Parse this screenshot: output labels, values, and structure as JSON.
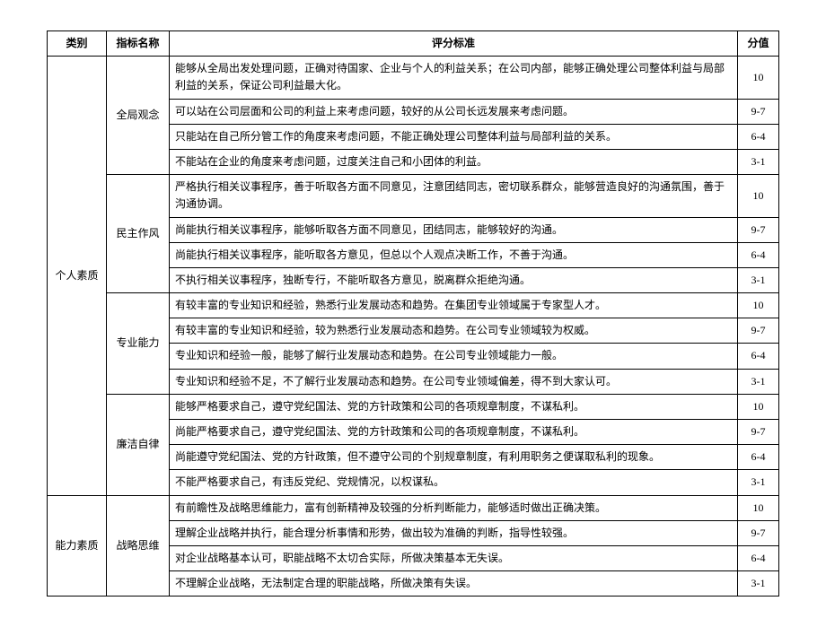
{
  "headers": {
    "category": "类别",
    "index": "指标名称",
    "criteria": "评分标准",
    "score": "分值"
  },
  "categories": [
    {
      "name": "个人素质",
      "indices": [
        {
          "name": "全局观念",
          "rows": [
            {
              "criteria": "能够从全局出发处理问题，正确对待国家、企业与个人的利益关系；在公司内部，能够正确处理公司整体利益与局部利益的关系，保证公司利益最大化。",
              "score": "10"
            },
            {
              "criteria": "可以站在公司层面和公司的利益上来考虑问题，较好的从公司长远发展来考虑问题。",
              "score": "9-7"
            },
            {
              "criteria": "只能站在自己所分管工作的角度来考虑问题，不能正确处理公司整体利益与局部利益的关系。",
              "score": "6-4"
            },
            {
              "criteria": "不能站在企业的角度来考虑问题，过度关注自己和小团体的利益。",
              "score": "3-1"
            }
          ]
        },
        {
          "name": "民主作风",
          "rows": [
            {
              "criteria": "严格执行相关议事程序，善于听取各方面不同意见，注意团结同志，密切联系群众，能够营造良好的沟通氛围，善于沟通协调。",
              "score": "10"
            },
            {
              "criteria": "尚能执行相关议事程序，能够听取各方面不同意见，团结同志，能够较好的沟通。",
              "score": "9-7"
            },
            {
              "criteria": "尚能执行相关议事程序，能听取各方意见，但总以个人观点决断工作，不善于沟通。",
              "score": "6-4"
            },
            {
              "criteria": "不执行相关议事程序，独断专行，不能听取各方意见，脱离群众拒绝沟通。",
              "score": "3-1"
            }
          ]
        },
        {
          "name": "专业能力",
          "rows": [
            {
              "criteria": "有较丰富的专业知识和经验，熟悉行业发展动态和趋势。在集团专业领域属于专家型人才。",
              "score": "10"
            },
            {
              "criteria": "有较丰富的专业知识和经验，较为熟悉行业发展动态和趋势。在公司专业领域较为权威。",
              "score": "9-7"
            },
            {
              "criteria": "专业知识和经验一般，能够了解行业发展动态和趋势。在公司专业领域能力一般。",
              "score": "6-4"
            },
            {
              "criteria": "专业知识和经验不足，不了解行业发展动态和趋势。在公司专业领域偏差，得不到大家认可。",
              "score": "3-1"
            }
          ]
        },
        {
          "name": "廉洁自律",
          "rows": [
            {
              "criteria": "能够严格要求自己，遵守党纪国法、党的方针政策和公司的各项规章制度，不谋私利。",
              "score": "10"
            },
            {
              "criteria": "尚能严格要求自己，遵守党纪国法、党的方针政策和公司的各项规章制度，不谋私利。",
              "score": "9-7"
            },
            {
              "criteria": "尚能遵守党纪国法、党的方针政策，但不遵守公司的个别规章制度，有利用职务之便谋取私利的现象。",
              "score": "6-4"
            },
            {
              "criteria": "不能严格要求自己，有违反党纪、党规情况，以权谋私。",
              "score": "3-1"
            }
          ]
        }
      ]
    },
    {
      "name": "能力素质",
      "indices": [
        {
          "name": "战略思维",
          "rows": [
            {
              "criteria": "有前瞻性及战略思维能力，富有创新精神及较强的分析判断能力，能够适时做出正确决策。",
              "score": "10"
            },
            {
              "criteria": "理解企业战略并执行，能合理分析事情和形势，做出较为准确的判断，指导性较强。",
              "score": "9-7"
            },
            {
              "criteria": "对企业战略基本认可，职能战略不太切合实际，所做决策基本无失误。",
              "score": "6-4"
            },
            {
              "criteria": "不理解企业战略，无法制定合理的职能战略，所做决策有失误。",
              "score": "3-1"
            }
          ]
        }
      ]
    }
  ]
}
